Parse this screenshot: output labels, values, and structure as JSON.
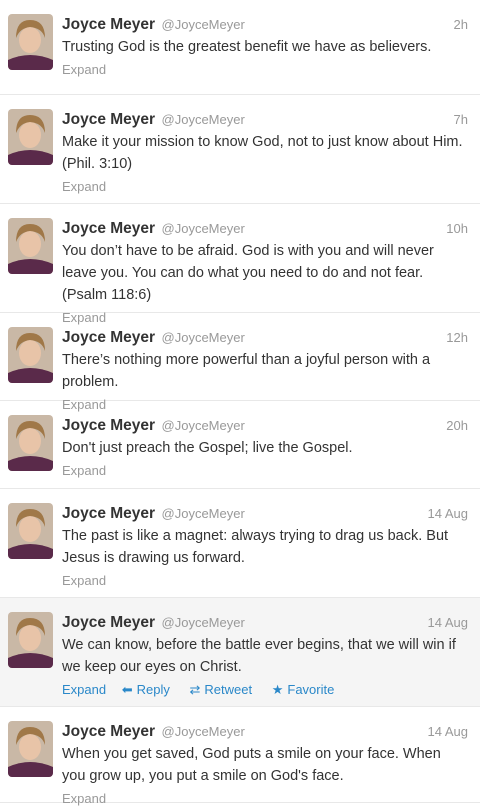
{
  "tweets": [
    {
      "name": "Joyce Meyer",
      "handle": "@JoyceMeyer",
      "time": "2h",
      "text": "Trusting God is the greatest benefit we have as believers.",
      "expand": "Expand"
    },
    {
      "name": "Joyce Meyer",
      "handle": "@JoyceMeyer",
      "time": "7h",
      "text": "Make it your mission to know God, not to just know about Him. (Phil. 3:10)",
      "expand": "Expand"
    },
    {
      "name": "Joyce Meyer",
      "handle": "@JoyceMeyer",
      "time": "10h",
      "text": "You don’t have to be afraid. God is with you and will never leave you. You can do what you need to do and not fear. (Psalm 118:6)",
      "expand": "Expand"
    },
    {
      "name": "Joyce Meyer",
      "handle": "@JoyceMeyer",
      "time": "12h",
      "text": "There’s nothing more powerful than a joyful person with a problem.",
      "expand": "Expand"
    },
    {
      "name": "Joyce Meyer",
      "handle": "@JoyceMeyer",
      "time": "20h",
      "text": "Don't just preach the Gospel; live the Gospel.",
      "expand": "Expand"
    },
    {
      "name": "Joyce Meyer",
      "handle": "@JoyceMeyer",
      "time": "14 Aug",
      "text": "The past is like a magnet: always trying to drag us back. But Jesus is drawing us forward.",
      "expand": "Expand"
    },
    {
      "name": "Joyce Meyer",
      "handle": "@JoyceMeyer",
      "time": "14 Aug",
      "text": "We can know, before the battle ever begins, that we will win if we keep our eyes on Christ.",
      "expand": "Expand",
      "reply": "Reply",
      "retweet": "Retweet",
      "favorite": "Favorite"
    },
    {
      "name": "Joyce Meyer",
      "handle": "@JoyceMeyer",
      "time": "14 Aug",
      "text": "When you get saved, God puts a smile on your face. When you grow up, you put a smile on God's face.",
      "expand": "Expand"
    }
  ],
  "icons": {
    "reply": "reply-arrow-icon",
    "retweet": "retweet-icon",
    "favorite": "star-icon"
  },
  "colors": {
    "link": "#2a88c9",
    "muted": "#999999",
    "highlight_bg": "#f5f5f5"
  }
}
